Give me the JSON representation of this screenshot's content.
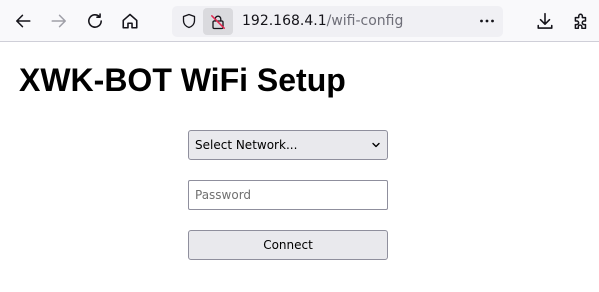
{
  "browser": {
    "url_host": "192.168.4.1",
    "url_path": "/wifi-config",
    "icons": {
      "back": "back-arrow-icon",
      "forward": "forward-arrow-icon",
      "reload": "reload-icon",
      "home": "home-icon",
      "tracking": "shield-icon",
      "insecure": "insecure-lock-icon",
      "menu": "more-dots-icon",
      "downloads": "download-icon",
      "extensions": "extensions-icon"
    },
    "colors": {
      "toolbar_bg": "#f9f9fb",
      "urlbar_bg": "#f0f0f4",
      "icon": "#15141a",
      "icon_disabled": "#a0a0a8",
      "insecure_icon": "#e22850"
    }
  },
  "page": {
    "title": "XWK-BOT WiFi Setup",
    "network_select": {
      "selected": "Select Network..."
    },
    "password": {
      "value": "",
      "placeholder": "Password"
    },
    "connect_label": "Connect"
  }
}
